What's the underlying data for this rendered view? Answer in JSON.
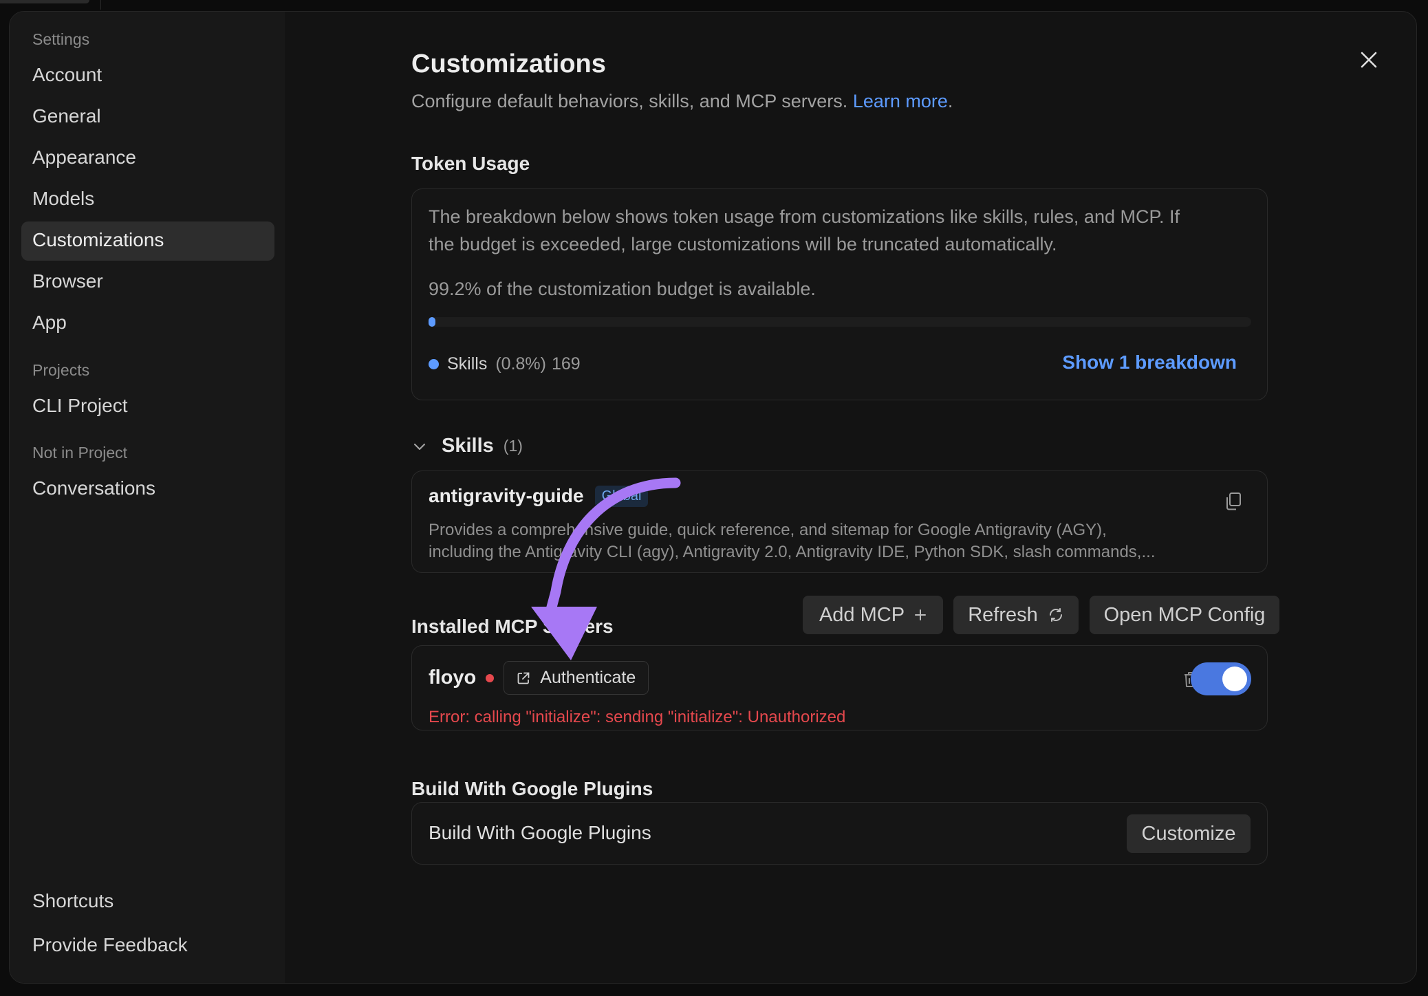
{
  "sidebar": {
    "settings_caption": "Settings",
    "items": [
      "Account",
      "General",
      "Appearance",
      "Models",
      "Customizations",
      "Browser",
      "App"
    ],
    "active_item": "Customizations",
    "projects_caption": "Projects",
    "project_items": [
      "CLI Project"
    ],
    "not_in_project_caption": "Not in Project",
    "other_items": [
      "Conversations"
    ],
    "footer_items": [
      "Shortcuts",
      "Provide Feedback"
    ]
  },
  "header": {
    "title": "Customizations",
    "subtitle": "Configure default behaviors, skills, and MCP servers.",
    "learn_more": "Learn more",
    "period": "."
  },
  "token_usage": {
    "title": "Token Usage",
    "description_line1": "The breakdown below shows token usage from customizations like skills, rules, and MCP. If",
    "description_line2": "the budget is exceeded, large customizations will be truncated automatically.",
    "available_text": "99.2% of the customization budget is available.",
    "used_fraction": 0.008,
    "legend_label": "Skills",
    "legend_percent": "(0.8%)",
    "legend_count": "169",
    "show_breakdown": "Show 1 breakdown"
  },
  "skills": {
    "title": "Skills",
    "count": "(1)",
    "items": [
      {
        "name": "antigravity-guide",
        "badge": "Global",
        "desc_line1": "Provides a comprehensive guide, quick reference, and sitemap for Google Antigravity (AGY),",
        "desc_line2": "including the Antigravity CLI (agy), Antigravity 2.0, Antigravity IDE, Python SDK, slash commands,..."
      }
    ]
  },
  "mcp": {
    "title": "Installed MCP Servers",
    "add_label": "Add MCP",
    "refresh_label": "Refresh",
    "open_config_label": "Open MCP Config",
    "servers": [
      {
        "name": "floyo",
        "authenticate_label": "Authenticate",
        "error": "Error: calling \"initialize\": sending \"initialize\": Unauthorized",
        "enabled": true
      }
    ]
  },
  "plugins": {
    "title": "Build With Google Plugins",
    "row_label": "Build With Google Plugins",
    "customize_label": "Customize"
  },
  "colors": {
    "accent": "#5d9bff",
    "error": "#e5484d",
    "toggle": "#4a78e0",
    "annotation_arrow": "#a778f5"
  },
  "icons": [
    "close-icon",
    "chevron-down-icon",
    "copy-icon",
    "plus-icon",
    "refresh-icon",
    "external-link-icon",
    "trash-icon",
    "arrow-annotation"
  ]
}
